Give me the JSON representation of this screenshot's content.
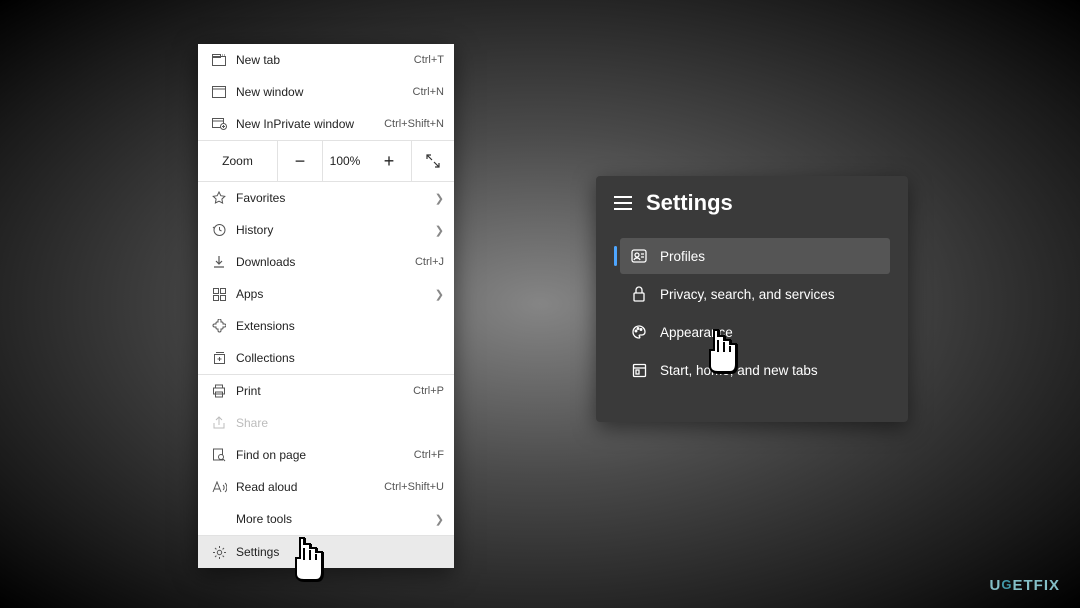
{
  "menu": {
    "new_tab": {
      "label": "New tab",
      "shortcut": "Ctrl+T"
    },
    "new_window": {
      "label": "New window",
      "shortcut": "Ctrl+N"
    },
    "new_inprivate": {
      "label": "New InPrivate window",
      "shortcut": "Ctrl+Shift+N"
    },
    "zoom": {
      "label": "Zoom",
      "value": "100%"
    },
    "favorites": {
      "label": "Favorites"
    },
    "history": {
      "label": "History"
    },
    "downloads": {
      "label": "Downloads",
      "shortcut": "Ctrl+J"
    },
    "apps": {
      "label": "Apps"
    },
    "extensions": {
      "label": "Extensions"
    },
    "collections": {
      "label": "Collections"
    },
    "print": {
      "label": "Print",
      "shortcut": "Ctrl+P"
    },
    "share": {
      "label": "Share"
    },
    "find": {
      "label": "Find on page",
      "shortcut": "Ctrl+F"
    },
    "read_aloud": {
      "label": "Read aloud",
      "shortcut": "Ctrl+Shift+U"
    },
    "more_tools": {
      "label": "More tools"
    },
    "settings": {
      "label": "Settings"
    }
  },
  "settings_panel": {
    "title": "Settings",
    "items": {
      "profiles": {
        "label": "Profiles"
      },
      "privacy": {
        "label": "Privacy, search, and services"
      },
      "appearance": {
        "label": "Appearance"
      },
      "start": {
        "label": "Start, home, and new tabs"
      }
    }
  },
  "watermark": "UGETFIX"
}
